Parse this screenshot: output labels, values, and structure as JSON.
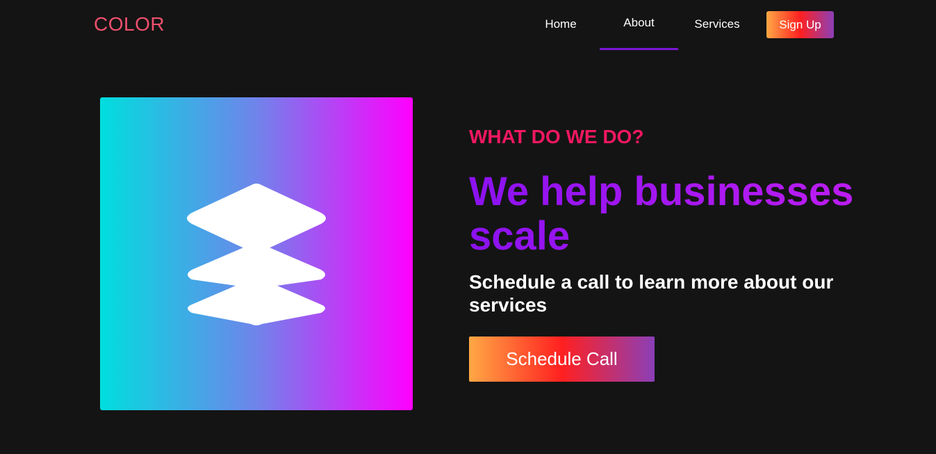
{
  "colors": {
    "background": "#141414",
    "logo": "#f0506e",
    "kicker": "#f0185f",
    "headline_from": "#8b12f0",
    "headline_to": "#c21ef2",
    "nav_underline": "#7a16d4",
    "cta_gradient": [
      "#ffa845",
      "#ff2020",
      "#8b3fb7"
    ],
    "hero_gradient": [
      "#00dede",
      "#6f84eb",
      "#ff00ff"
    ]
  },
  "header": {
    "logo": "COLOR",
    "nav": {
      "home": "Home",
      "about": "About",
      "services": "Services",
      "active": "About"
    },
    "signup_label": "Sign Up"
  },
  "hero": {
    "icon": "layers-icon",
    "kicker": "WHAT DO WE DO?",
    "headline": "We help businesses scale",
    "subtext": "Schedule a call to learn more about our services",
    "cta_label": "Schedule Call"
  }
}
